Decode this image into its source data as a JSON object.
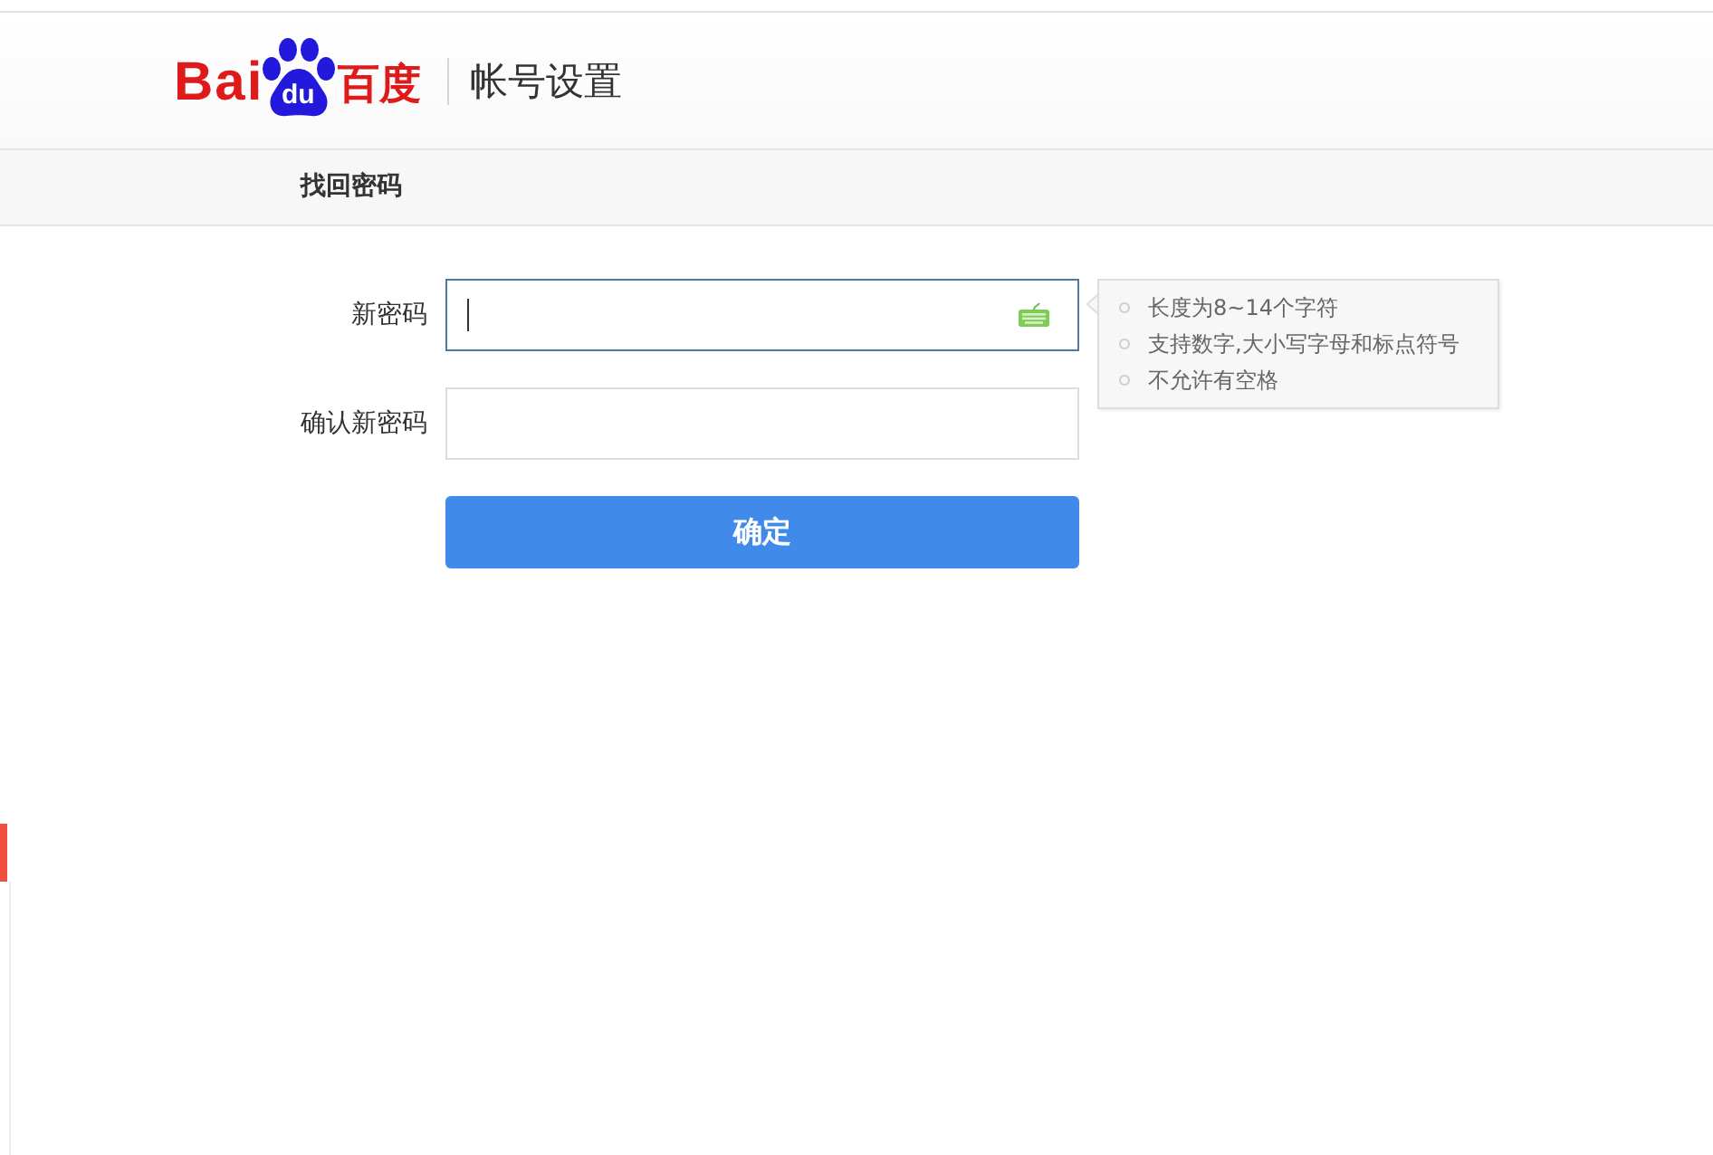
{
  "header": {
    "logo": {
      "prefix": "Bai",
      "paw_text": "du",
      "suffix": "百度"
    },
    "title": "帐号设置"
  },
  "subnav": {
    "title": "找回密码"
  },
  "form": {
    "fields": [
      {
        "label": "新密码",
        "focused": true
      },
      {
        "label": "确认新密码",
        "focused": false
      }
    ],
    "submit": "确定"
  },
  "hint": {
    "items": [
      "长度为8~14个字符",
      "支持数字,大小写字母和标点符号",
      "不允许有空格"
    ]
  }
}
